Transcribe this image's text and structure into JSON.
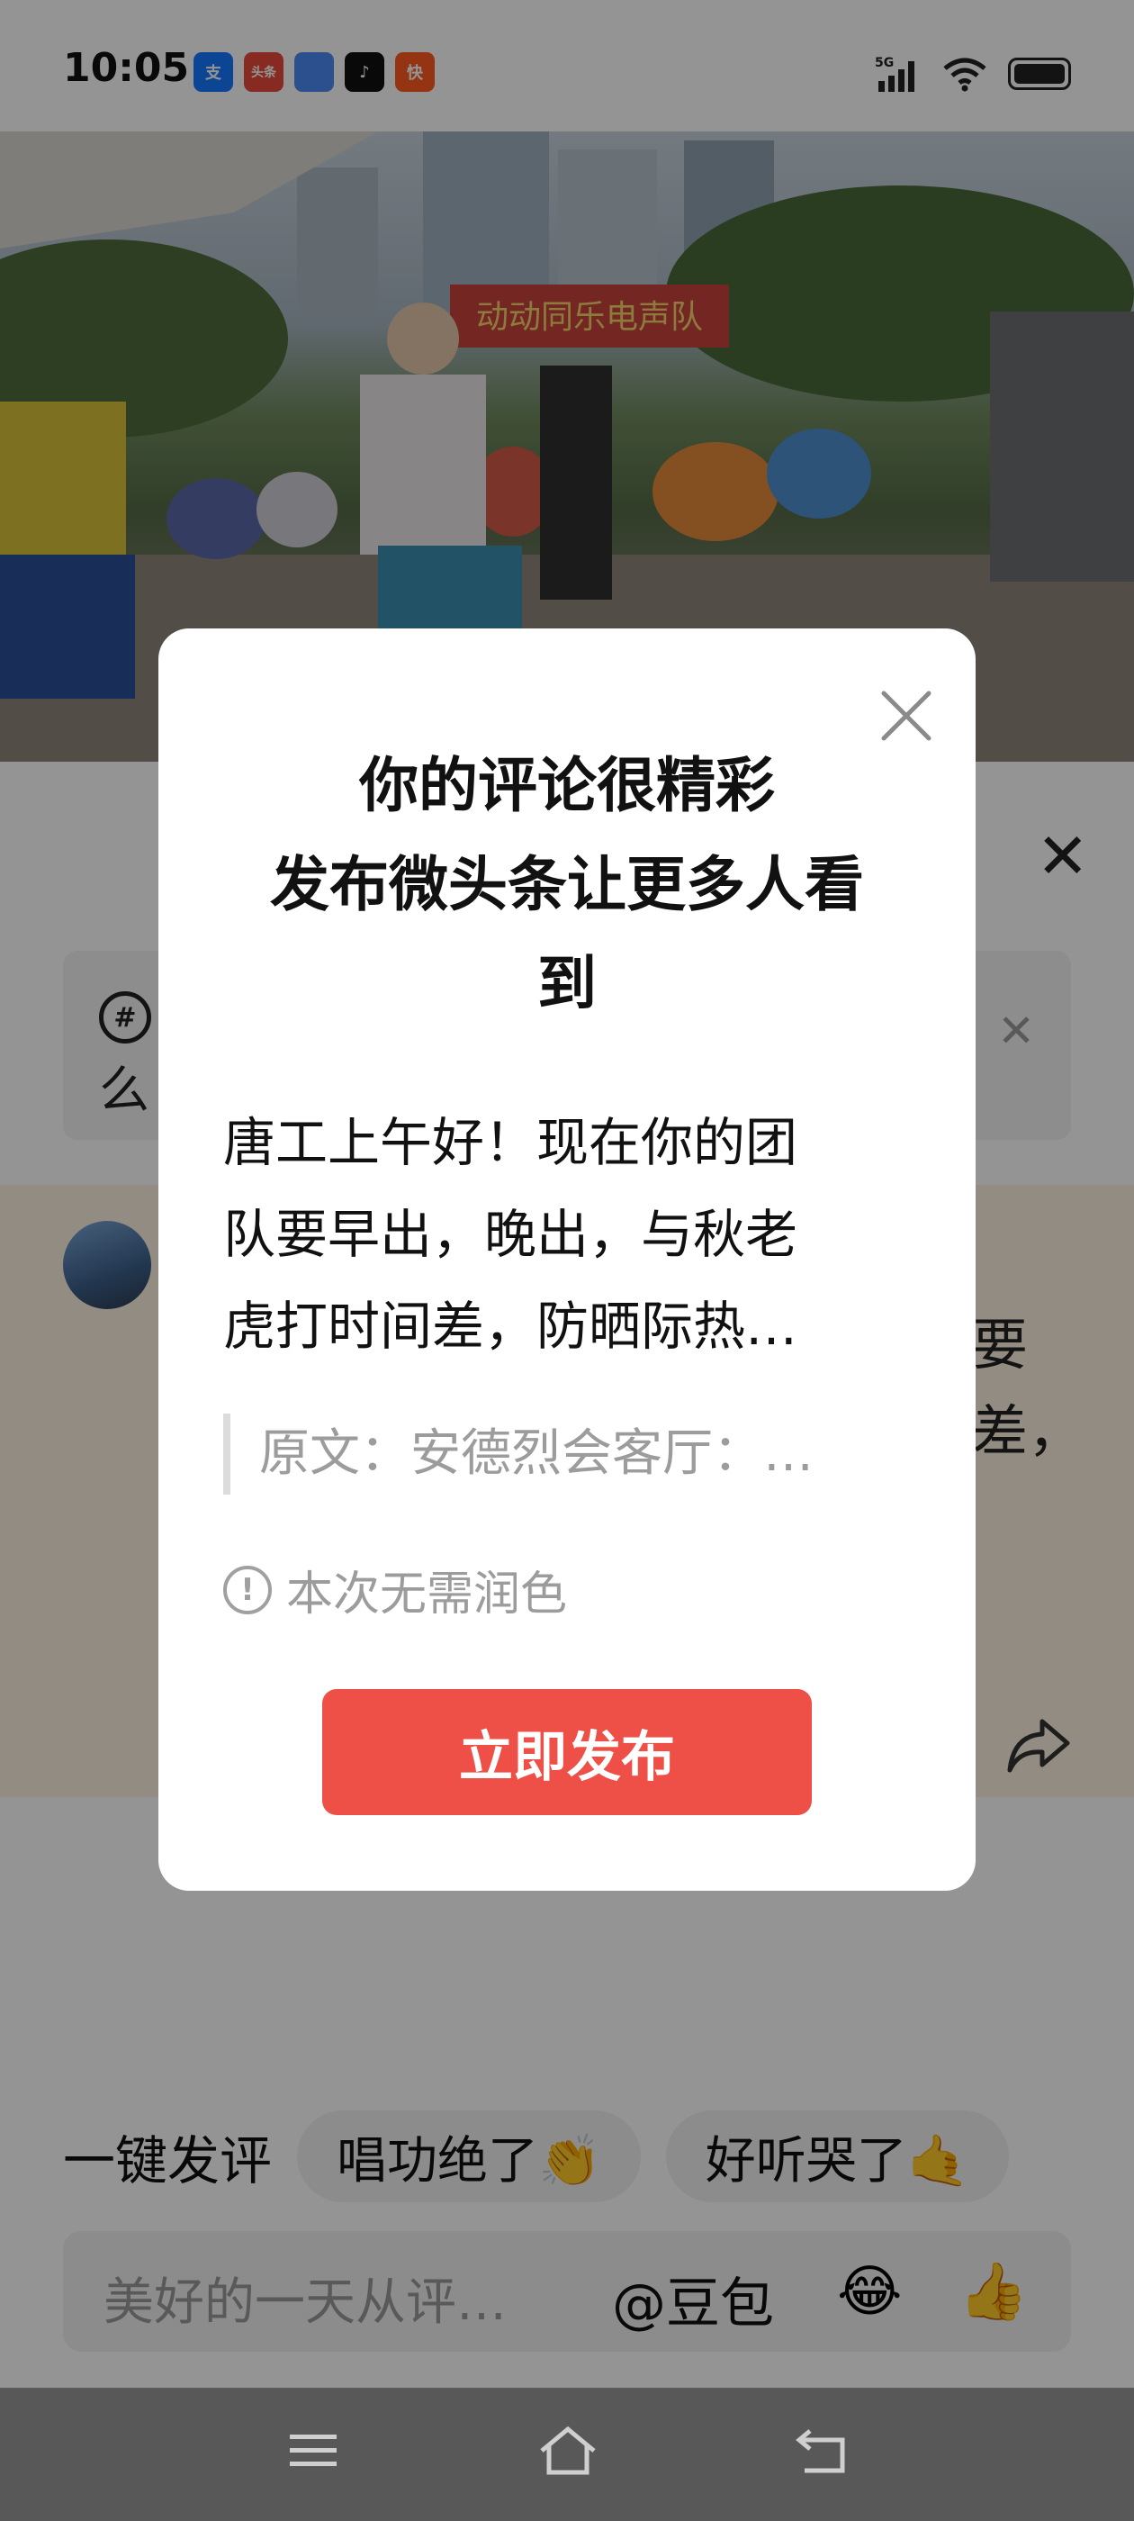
{
  "status_bar": {
    "time": "10:05",
    "apps": [
      {
        "icon": "alipay-icon",
        "glyph": "支",
        "color": "#1677ff"
      },
      {
        "icon": "toutiao-icon",
        "glyph": "头条",
        "color": "#e94b3c"
      },
      {
        "icon": "note-app-icon",
        "glyph": "",
        "color": "#4c8bf5"
      },
      {
        "icon": "tiktok-icon",
        "glyph": "♪",
        "color": "#111111"
      },
      {
        "icon": "kuaishou-icon",
        "glyph": "快",
        "color": "#ff5a1f"
      }
    ],
    "network": "5G"
  },
  "video": {
    "banner_text": "动动同乐电声队"
  },
  "sheet": {
    "topic_text": "么",
    "comment_fragment_1": "要",
    "comment_fragment_2": "差，"
  },
  "quick_reply": {
    "label": "一键发评",
    "pills": [
      "唱功绝了👏",
      "好听哭了🤙"
    ]
  },
  "input_bar": {
    "placeholder": "美好的一天从评…",
    "mention": "@豆包",
    "emoji_1": "😂",
    "emoji_2": "👍"
  },
  "dialog": {
    "title_line_1": "你的评论很精彩",
    "title_line_2": "发布微头条让更多人看",
    "title_line_3": "到",
    "body_line_1": "唐工上午好！现在你的团",
    "body_line_2": "队要早出，晚出，与秋老",
    "body_line_3": "虎打时间差，防晒际热…",
    "quote": "原文：安德烈会客厅：…",
    "hint": "本次无需润色",
    "publish_label": "立即发布"
  },
  "colors": {
    "accent": "#ee5047",
    "overlay": "rgba(0,0,0,0.42)"
  }
}
